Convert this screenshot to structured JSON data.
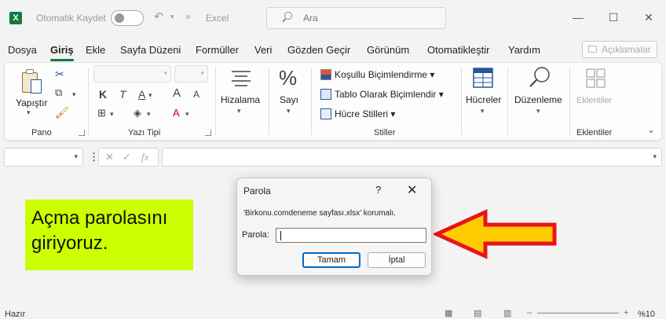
{
  "titlebar": {
    "autosave_label": "Otomatik Kaydet",
    "app_name": "Excel",
    "search_placeholder": "Ara",
    "minimize": "—",
    "restore": "☐",
    "close": "✕"
  },
  "menu": {
    "tabs": [
      "Dosya",
      "Giriş",
      "Ekle",
      "Sayfa Düzeni",
      "Formüller",
      "Veri",
      "Gözden Geçir",
      "Görünüm",
      "Otomatikleştir",
      "Yardım"
    ],
    "active_tab": "Giriş",
    "comments_label": "Açıklamalar"
  },
  "ribbon": {
    "clipboard": {
      "paste_label": "Yapıştır",
      "group_label": "Pano"
    },
    "font": {
      "bold": "K",
      "italic": "T",
      "underline": "A",
      "grow": "A",
      "shrink": "A",
      "group_label": "Yazı Tipi"
    },
    "alignment": {
      "label": "Hizalama"
    },
    "number": {
      "label": "Sayı"
    },
    "styles": {
      "conditional": "Koşullu Biçimlendirme",
      "table": "Tablo Olarak Biçimlendir",
      "cell_styles": "Hücre Stilleri",
      "group_label": "Stiller"
    },
    "cells": {
      "label": "Hücreler"
    },
    "editing": {
      "label": "Düzenleme"
    },
    "addins": {
      "label": "Eklentiler",
      "group_label": "Eklentiler"
    }
  },
  "formula_bar": {
    "cancel": "✕",
    "enter": "✓",
    "fx": "fx"
  },
  "annotation": {
    "text_line1": "Açma parolasını",
    "text_line2": "giriyoruz.",
    "color": "#ccff00",
    "arrow_fill": "#ffcc00",
    "arrow_stroke": "#e8141b"
  },
  "dialog": {
    "title": "Parola",
    "help": "?",
    "close": "✕",
    "message": "'Birkonu.comdeneme sayfası.xlsx' korumalı.",
    "password_label": "Parola:",
    "password_value": "",
    "ok_label": "Tamam",
    "cancel_label": "İptal"
  },
  "status": {
    "ready": "Hazır",
    "zoom": "%10"
  },
  "colors": {
    "accent": "#107c41",
    "dialog_primary": "#0067c0"
  }
}
